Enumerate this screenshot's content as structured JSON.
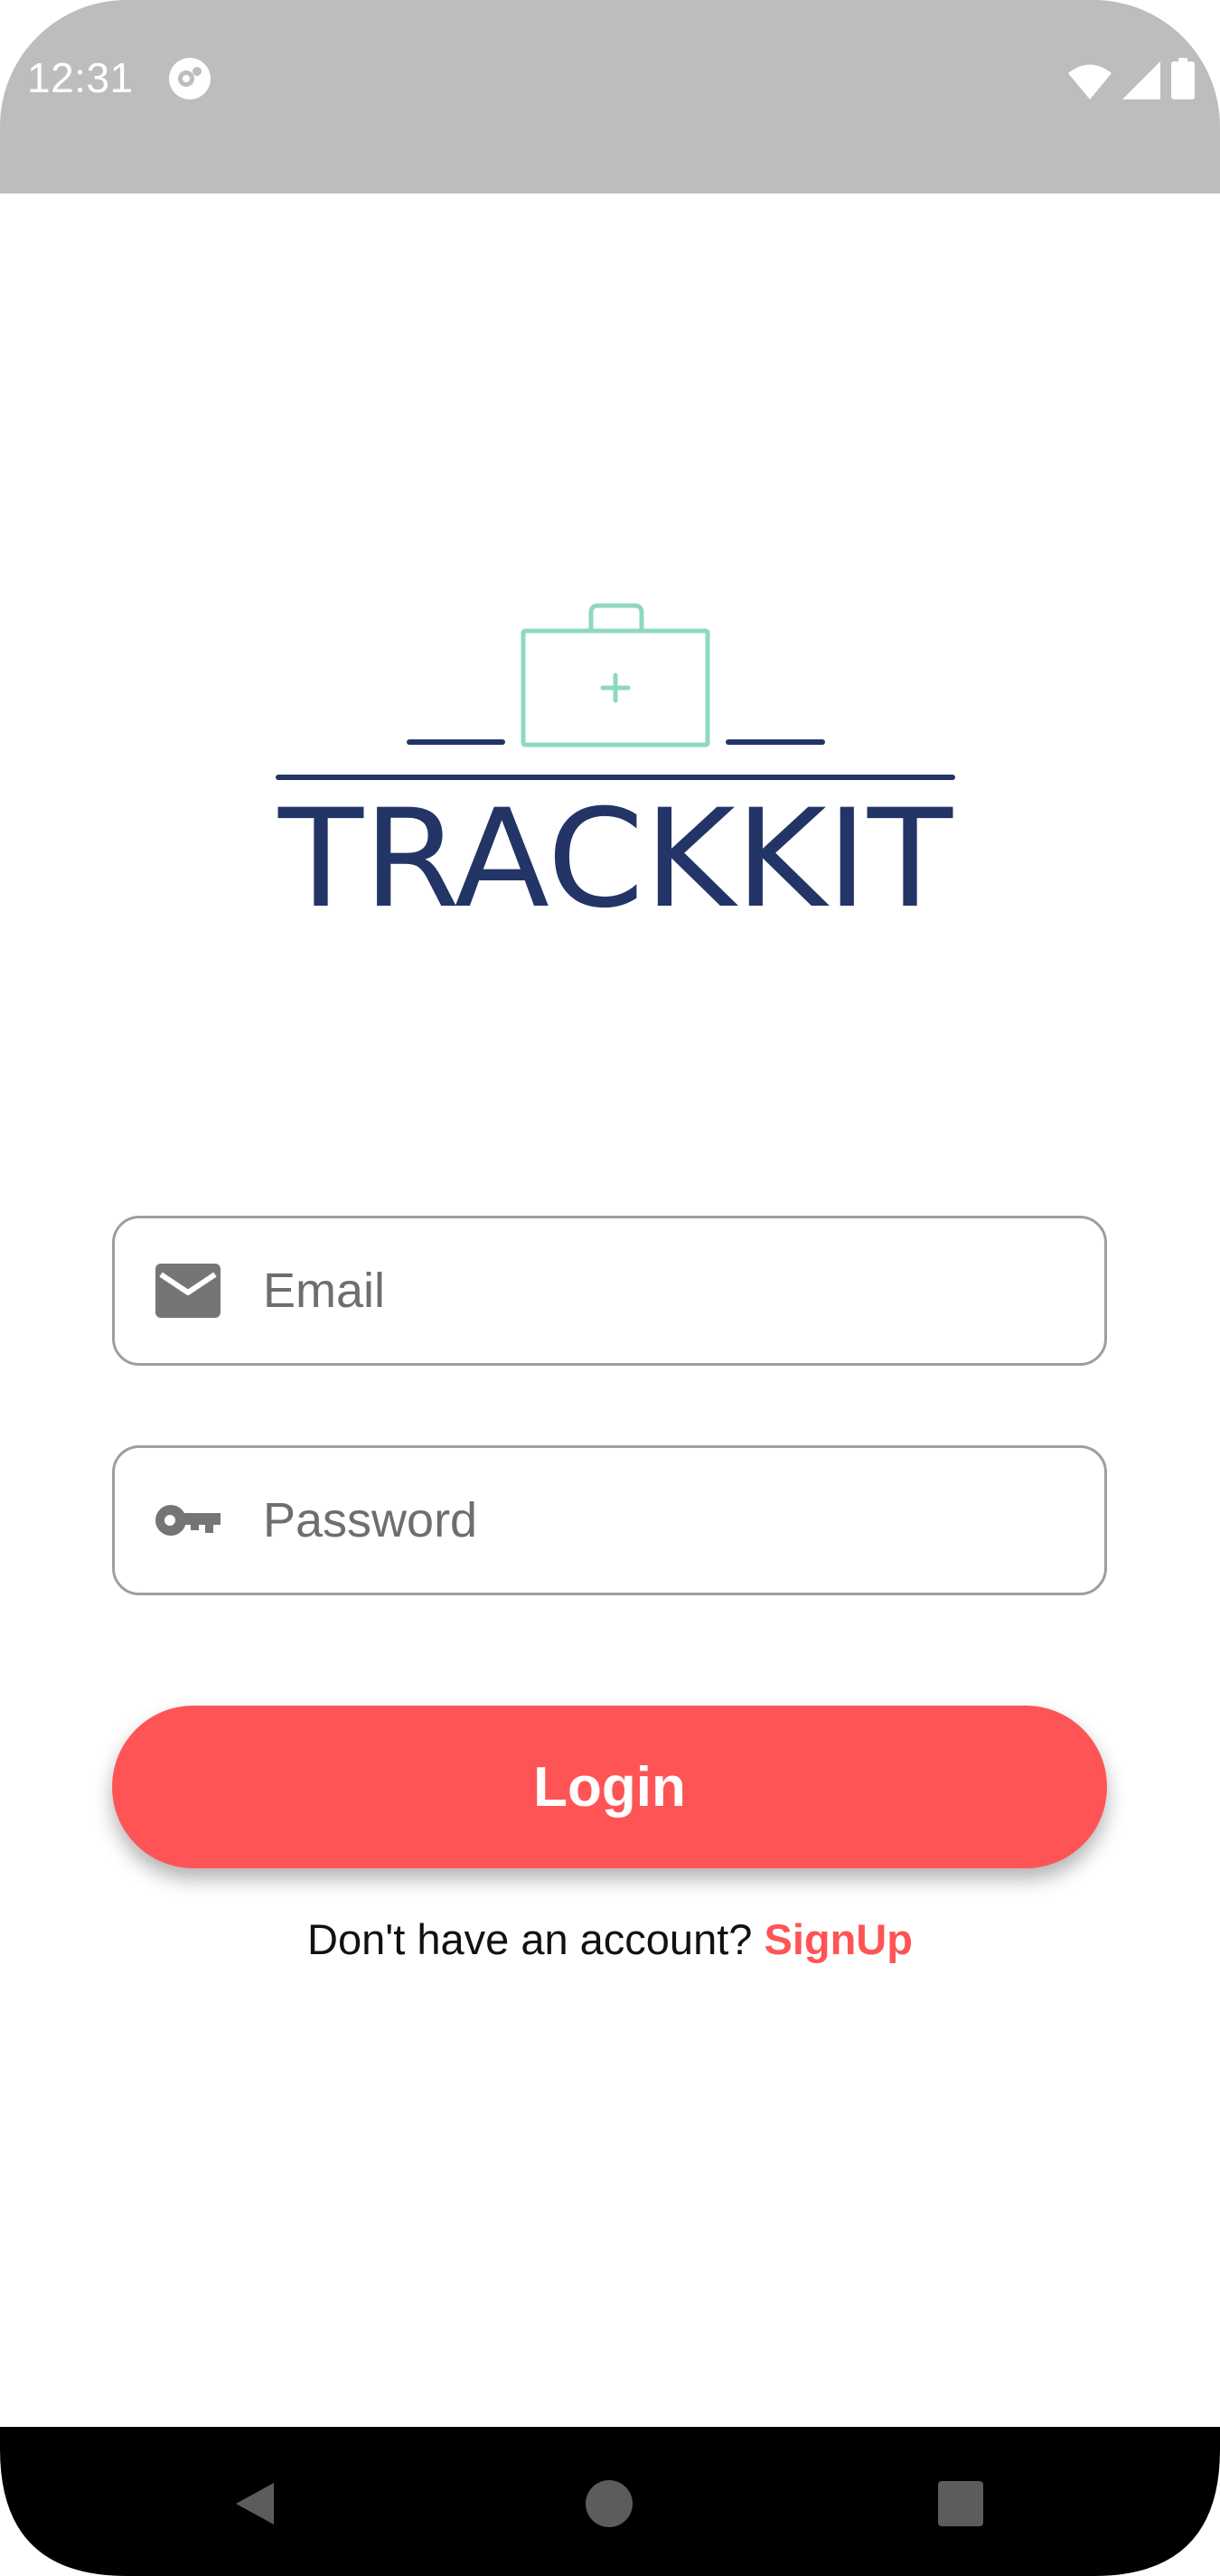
{
  "status_bar": {
    "time": "12:31",
    "background": "#bdbdbd",
    "icons": [
      "app-notification-icon",
      "wifi-icon",
      "signal-icon",
      "battery-icon"
    ]
  },
  "logo": {
    "wordmark": "TRACKKIT",
    "wordmark_color": "#233466",
    "kit_icon_color": "#8fd8c0",
    "kit_icon": "first-aid-kit-icon"
  },
  "login_form": {
    "email": {
      "placeholder": "Email",
      "value": "",
      "icon": "mail-icon"
    },
    "password": {
      "placeholder": "Password",
      "value": "",
      "icon": "key-icon"
    },
    "login_label": "Login",
    "signup_prompt": "Don't have an account?",
    "signup_label": "SignUp",
    "accent_color": "#ff5456"
  },
  "nav_bar": {
    "icons": [
      "back-icon",
      "home-icon",
      "recents-icon"
    ]
  }
}
